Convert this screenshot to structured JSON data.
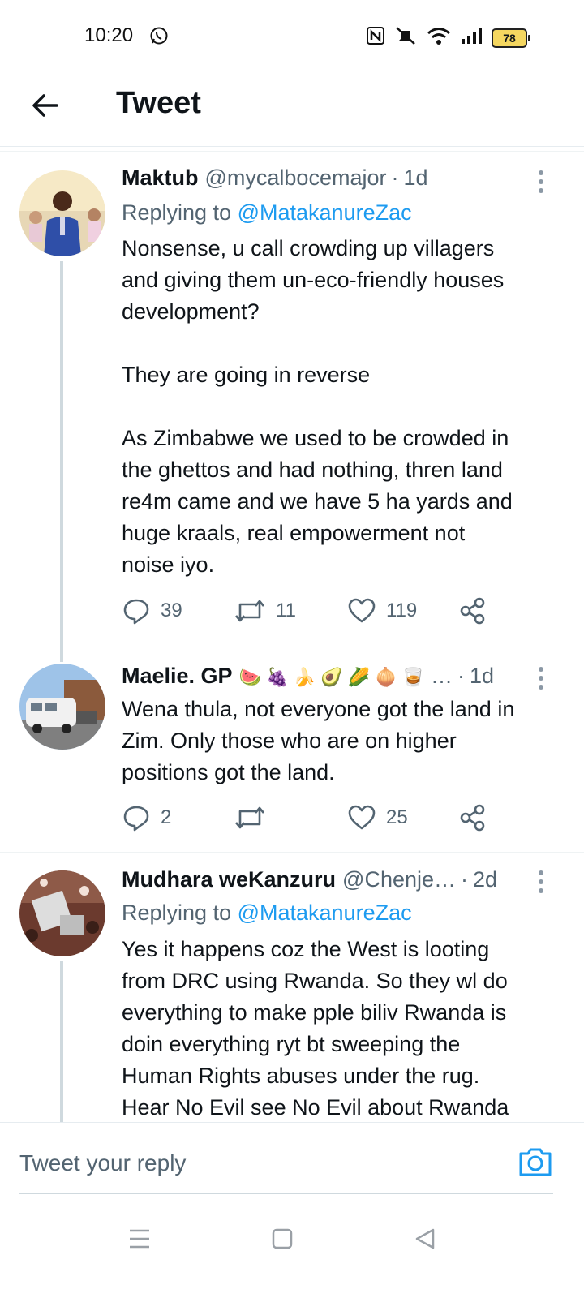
{
  "status": {
    "time": "10:20",
    "battery": "78"
  },
  "header": {
    "title": "Tweet"
  },
  "tweets": [
    {
      "name": "Maktub",
      "handle": "@mycalbocemajor",
      "time": "1d",
      "replying_prefix": "Replying to ",
      "replying_to": "@MatakanureZac",
      "text": "Nonsense, u call crowding up villagers\nand giving them un-eco-friendly houses\ndevelopment?\n\nThey are going in reverse\n\nAs Zimbabwe we used to be crowded in\nthe ghettos and had nothing, thren land\nre4m came and we have 5 ha yards and\nhuge kraals, real empowerment not\nnoise iyo.",
      "replies": "39",
      "retweets": "11",
      "likes": "119"
    },
    {
      "name": "Maelie. GP",
      "emojis": "🍉 🍇 🍌 🥑 🌽 🧅 🥃",
      "handle": "…",
      "time": "1d",
      "text": "Wena thula, not everyone got the land in\nZim. Only those who are on higher\npositions got the land.",
      "replies": "2",
      "retweets": "",
      "likes": "25"
    },
    {
      "name": "Mudhara weKanzuru",
      "handle": "@Chenje…",
      "time": "2d",
      "replying_prefix": "Replying to ",
      "replying_to": "@MatakanureZac",
      "text": "Yes it happens coz the West is looting\nfrom DRC using Rwanda. So they wl do\neverything to make pple biliv Rwanda is\ndoin everything ryt bt sweeping the\nHuman Rights abuses under the rug.\nHear No Evil see No Evil about Rwanda"
    }
  ],
  "reply_bar": {
    "placeholder": "Tweet your reply"
  },
  "icons": {
    "back": "arrow-left-icon",
    "reply": "comment-icon",
    "retweet": "retweet-icon",
    "like": "heart-icon",
    "share": "share-icon",
    "camera": "camera-icon"
  },
  "colors": {
    "accent": "#1d9bf0",
    "muted": "#536471",
    "text": "#0f1419"
  }
}
